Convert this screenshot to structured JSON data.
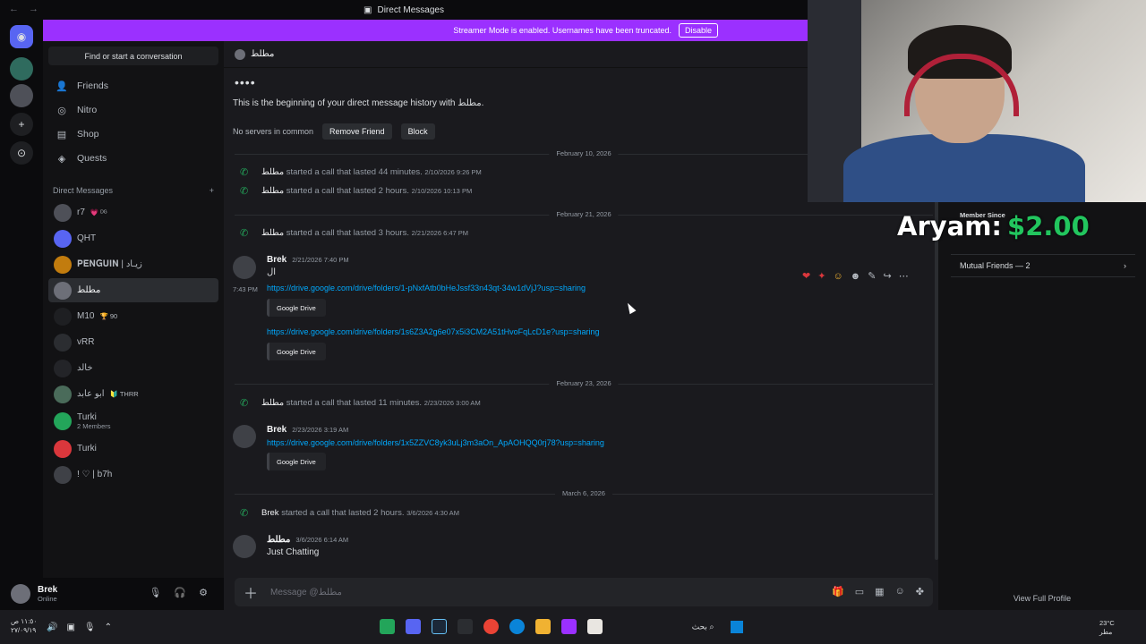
{
  "window": {
    "title": "Direct Messages",
    "nav": "← →"
  },
  "banner": {
    "text": "Streamer Mode is enabled. Usernames have been truncated.",
    "disable_label": "Disable"
  },
  "sidebar": {
    "search_label": "Find or start a conversation",
    "nav": [
      {
        "label": "Friends",
        "icon": "friends-icon"
      },
      {
        "label": "Nitro",
        "icon": "nitro-icon"
      },
      {
        "label": "Shop",
        "icon": "shop-icon"
      },
      {
        "label": "Quests",
        "icon": "quests-icon"
      }
    ],
    "dm_header": "Direct Messages",
    "dm_add": "+",
    "dms": [
      {
        "name": "r7",
        "badge": "💗 ᴰᴳ",
        "color": "#4e5058"
      },
      {
        "name": "QHT",
        "badge": "",
        "color": "#5865f2"
      },
      {
        "name": "𝐏𝐄𝐍𝐆𝐔𝐈𝐍 | زيـاد",
        "badge": "",
        "color": "#c27c0e"
      },
      {
        "name": "مطلط",
        "badge": "",
        "color": "#6d6f78"
      },
      {
        "name": "M10",
        "badge": "🏆 90",
        "color": "#1e1f22"
      },
      {
        "name": "vRR",
        "badge": "",
        "color": "#2b2d31"
      },
      {
        "name": "خالد",
        "badge": "",
        "color": "#232428"
      },
      {
        "name": "ابو عابد",
        "badge": "🔰 THRR",
        "color": "#4a6b5a"
      },
      {
        "name": "Turki",
        "sub": "2 Members",
        "badge": "",
        "color": "#23a55a"
      },
      {
        "name": "Turki",
        "badge": "",
        "color": "#da373c"
      },
      {
        "name": "! ♡ | b7h",
        "badge": "",
        "color": "#3f4147"
      }
    ]
  },
  "user": {
    "name": "Brek",
    "status": "Online"
  },
  "chat": {
    "header_name": "مطلط",
    "intro_dots": "••••",
    "intro_text": "This is the beginning of your direct message history with مطلط.",
    "no_servers": "No servers in common",
    "remove_friend": "Remove Friend",
    "block": "Block",
    "dividers": [
      "February 10, 2026",
      "February 21, 2026",
      "February 23, 2026",
      "March 6, 2026"
    ],
    "calls": [
      {
        "who": "مطلط",
        "text": "started a call that lasted 44 minutes.",
        "ts": "2/10/2026 9:26 PM"
      },
      {
        "who": "مطلط",
        "text": "started a call that lasted 2 hours.",
        "ts": "2/10/2026 10:13 PM"
      },
      {
        "who": "مطلط",
        "text": "started a call that lasted 3 hours.",
        "ts": "2/21/2026 6:47 PM"
      },
      {
        "who": "مطلط",
        "text": "started a call that lasted 11 minutes.",
        "ts": "2/23/2026 3:00 AM"
      },
      {
        "who": "Brek",
        "text": "started a call that lasted 2 hours.",
        "ts": "3/6/2026 4:30 AM"
      }
    ],
    "msg1": {
      "author": "Brek",
      "ts": "2/21/2026 7:40 PM",
      "text": "ال",
      "hover_ts": "7:43 PM",
      "link1": "https://drive.google.com/drive/folders/1-pNxfAtb0bHeJssf33n43qt-34w1dVjJ?usp=sharing",
      "embed1": "Google Drive",
      "link2": "https://drive.google.com/drive/folders/1s6Z3A2g6e07x5i3CM2A51tHvoFqLcD1e?usp=sharing",
      "embed2": "Google Drive"
    },
    "msg2": {
      "author": "Brek",
      "ts": "2/23/2026 3:19 AM",
      "link": "https://drive.google.com/drive/folders/1x5ZZVC8yk3uLj3m3aOn_ApAOHQQ0rj78?usp=sharing",
      "embed": "Google Drive"
    },
    "msg3": {
      "author": "مطلط",
      "ts": "3/6/2026 6:14 AM",
      "text": "Just Chatting"
    },
    "composer_placeholder": "Message @مطلط"
  },
  "profile": {
    "member_since": "Member Since",
    "mutual": "Mutual Friends — 2",
    "full": "View Full Profile"
  },
  "donation": {
    "name": "Aryam:",
    "amount": "$2.00"
  },
  "taskbar": {
    "clock": [
      "١١:٥٠ ص",
      "٢٧/٠٩/١٩"
    ],
    "search": "بحث",
    "weather": [
      "23°C",
      "مطر"
    ]
  },
  "colors": {
    "accent": "#9b30ff",
    "link": "#00a8fc",
    "call": "#23a55a"
  }
}
